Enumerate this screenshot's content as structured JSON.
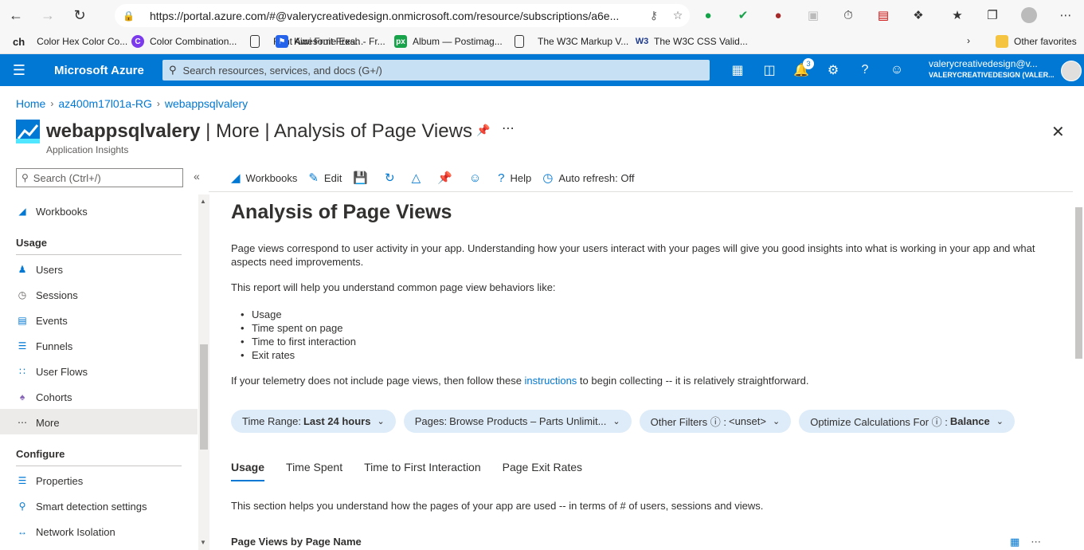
{
  "browser": {
    "url": "https://portal.azure.com/#@valerycreativedesign.onmicrosoft.com/resource/subscriptions/a6e...",
    "bookmarks": [
      {
        "label": "Color Hex Color Co...",
        "icon": "ch"
      },
      {
        "label": "Color Combination...",
        "icon": "C"
      },
      {
        "label": "Font Awesome Exa...",
        "icon": "page"
      },
      {
        "label": "Kiwi Fruit Fresh - Fr...",
        "icon": "flag"
      },
      {
        "label": "Album — Postimag...",
        "icon": "px"
      },
      {
        "label": "The W3C Markup V...",
        "icon": "page"
      },
      {
        "label": "The W3C CSS Valid...",
        "icon": "W3"
      },
      {
        "label": "Other favorites",
        "icon": "folder"
      }
    ],
    "bookmark_first_prefix": "ch"
  },
  "azure": {
    "brand": "Microsoft Azure",
    "search_placeholder": "Search resources, services, and docs (G+/)",
    "notifications_count": "3",
    "user_email": "valerycreativedesign@v...",
    "user_tenant": "VALERYCREATIVEDESIGN (VALER..."
  },
  "breadcrumb": [
    "Home",
    "az400m17l01a-RG",
    "webappsqlvalery"
  ],
  "page": {
    "title_bold": "webappsqlvalery",
    "title_rest": " | More | Analysis of Page Views",
    "subtitle": "Application Insights"
  },
  "sidebar": {
    "search_placeholder": "Search (Ctrl+/)",
    "workbooks": "Workbooks",
    "usage_header": "Usage",
    "usage_items": [
      "Users",
      "Sessions",
      "Events",
      "Funnels",
      "User Flows",
      "Cohorts",
      "More"
    ],
    "configure_header": "Configure",
    "configure_items": [
      "Properties",
      "Smart detection settings",
      "Network Isolation"
    ]
  },
  "toolbar": {
    "workbooks": "Workbooks",
    "edit": "Edit",
    "help": "Help",
    "auto_refresh": "Auto refresh: Off"
  },
  "content": {
    "title": "Analysis of Page Views",
    "intro": "Page views correspond to user activity in your app. Understanding how your users interact with your pages will give you good insights into what is working in your app and what aspects need improvements.",
    "report_line": "This report will help you understand common page view behaviors like:",
    "bullets": [
      "Usage",
      "Time spent on page",
      "Time to first interaction",
      "Exit rates"
    ],
    "telemetry_before": "If your telemetry does not include page views, then follow these ",
    "telemetry_link": "instructions",
    "telemetry_after": " to begin collecting -- it is relatively straightforward.",
    "filters": [
      {
        "label": "Time Range:",
        "value": "Last 24 hours"
      },
      {
        "label": "Pages:",
        "value": "Browse Products – Parts Unlimit..."
      },
      {
        "label": "Other Filters ⓘ :",
        "value": "<unset>"
      },
      {
        "label": "Optimize Calculations For ⓘ :",
        "value": "Balance"
      }
    ],
    "tabs": [
      "Usage",
      "Time Spent",
      "Time to First Interaction",
      "Page Exit Rates"
    ],
    "section_desc": "This section helps you understand how the pages of your app are used -- in terms of # of users, sessions and views.",
    "section_header": "Page Views by Page Name"
  }
}
